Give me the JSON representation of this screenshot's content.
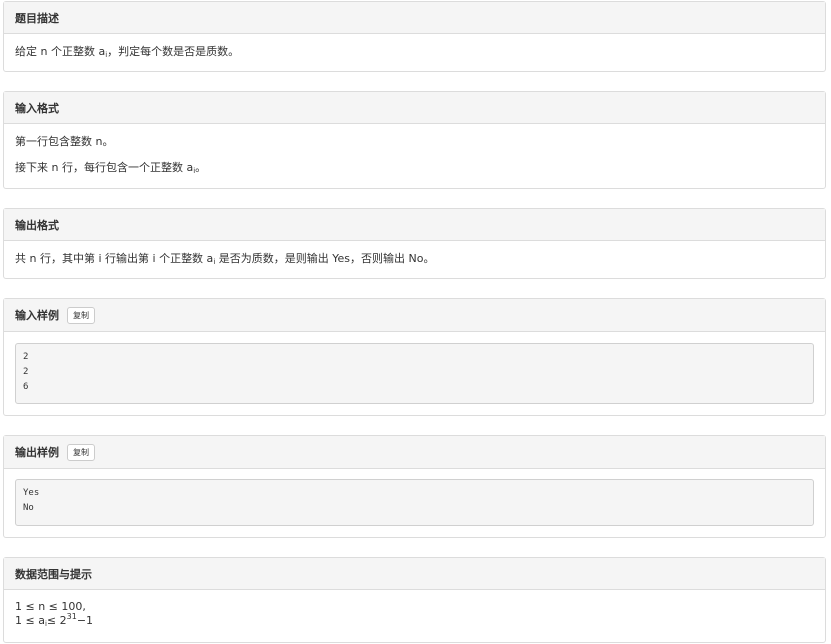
{
  "description": {
    "title": "题目描述",
    "text_prefix": "给定 n 个正整数 a",
    "text_sub": "i",
    "text_suffix": "，判定每个数是否是质数。"
  },
  "input_format": {
    "title": "输入格式",
    "line1": "第一行包含整数 n。",
    "line2_prefix": "接下来 n 行，每行包含一个正整数 a",
    "line2_sub": "i",
    "line2_suffix": "。"
  },
  "output_format": {
    "title": "输出格式",
    "text_prefix": "共 n 行，其中第 i 行输出第 i 个正整数 a",
    "text_sub": "i",
    "text_suffix": " 是否为质数，是则输出 Yes，否则输出 No。"
  },
  "input_sample": {
    "title": "输入样例",
    "copy_label": "复制",
    "lines": [
      "2",
      "2",
      "6"
    ]
  },
  "output_sample": {
    "title": "输出样例",
    "copy_label": "复制",
    "lines": [
      "Yes",
      "No"
    ]
  },
  "constraints": {
    "title": "数据范围与提示",
    "line1": "1 ≤ n ≤ 100,",
    "line2_prefix": "1 ≤ a",
    "line2_sub": "i",
    "line2_mid": "≤ 2",
    "line2_sup": "31",
    "line2_suffix": "−1"
  }
}
